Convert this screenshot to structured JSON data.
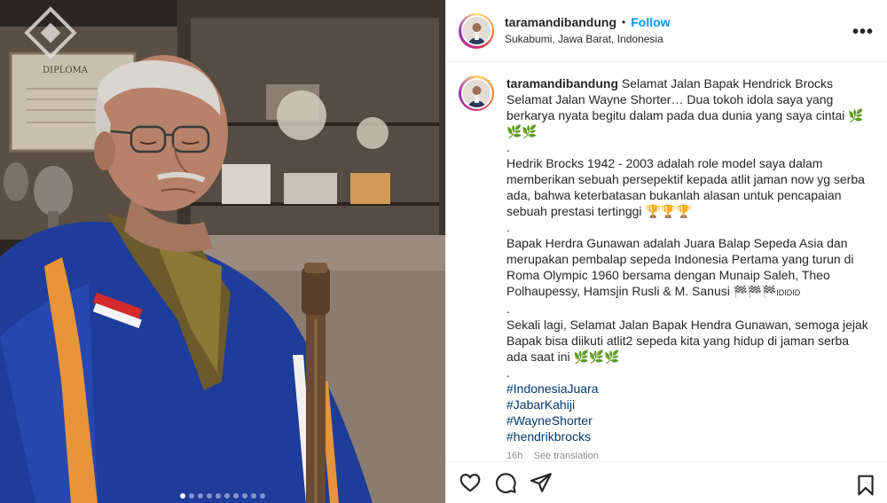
{
  "post": {
    "username": "taramandibandung",
    "follow_label": "Follow",
    "separator": "•",
    "location": "Sukabumi, Jawa Barat, Indonesia",
    "more_label": "•••"
  },
  "photo": {
    "diploma_text": "DIPLOMA",
    "carousel_count": 10,
    "carousel_active": 0
  },
  "caption": {
    "username": "taramandibandung",
    "line1": "Selamat Jalan Bapak Hendrick Brocks",
    "line2": "Selamat Jalan Wayne Shorter… Dua tokoh idola saya yang berkarya nyata begitu dalam pada dua dunia yang saya cintai",
    "leaves1": "🌿 🌿🌿",
    "dot1": ".",
    "para2": "Hedrik Brocks 1942 - 2003 adalah role model saya dalam memberikan sebuah persepektif kepada atlit jaman now yg serba ada, bahwa keterbatasan bukanlah alasan untuk pencapaian sebuah prestasi tertinggi",
    "trophies": "🏆🏆🏆",
    "dot2": ".",
    "para3": "Bapak Herdra Gunawan adalah Juara Balap Sepeda Asia dan merupakan pembalap sepeda Indonesia Pertama yang turun di Roma Olympic 1960 bersama dengan Munaip Saleh, Theo Polhaupessy, Hamsjin Rusli & M. Sanusi",
    "flags": "🏁🏁🏁",
    "flag_suffix": "IDIDID",
    "dot3": ".",
    "para4": "Sekali lagi, Selamat Jalan Bapak Hendra Gunawan, semoga jejak Bapak bisa diikuti atlit2 sepeda kita yang hidup di jaman serba ada saat ini",
    "leaves2": "🌿🌿🌿",
    "dot4": ".",
    "hashtags": [
      "#IndonesiaJuara",
      "#JabarKahiji",
      "#WayneShorter",
      "#hendrikbrocks"
    ],
    "time": "16h",
    "see_translation": "See translation"
  },
  "actions": {
    "like_icon": "heart-icon",
    "comment_icon": "comment-icon",
    "share_icon": "paper-plane-icon",
    "save_icon": "bookmark-icon"
  },
  "colors": {
    "follow": "#0095f6",
    "hashtag": "#00376b",
    "jacket": "#1e3c9a"
  }
}
